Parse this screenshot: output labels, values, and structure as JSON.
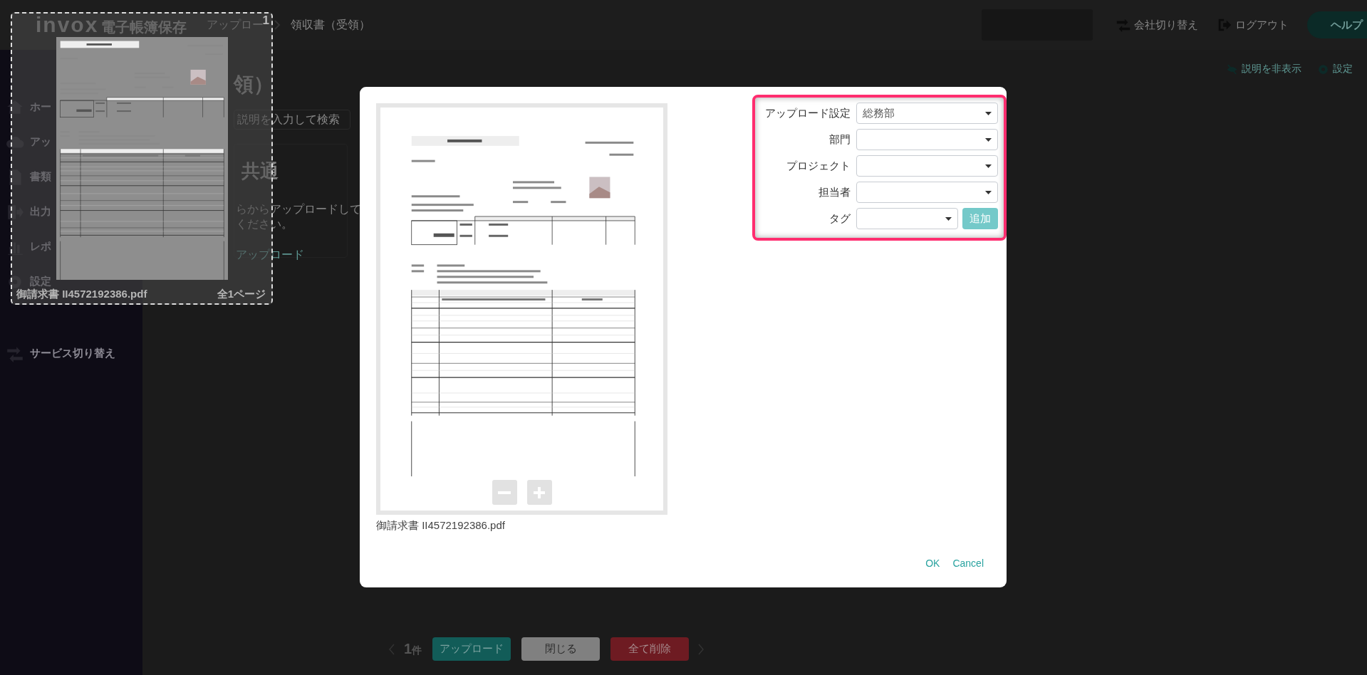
{
  "header": {
    "logo": "invox",
    "logo_subtitle": "電子帳簿保存",
    "breadcrumb": [
      "アップロー",
      "領収書（受領）"
    ],
    "actions": [
      {
        "kind": "switch",
        "label": "会社切り替え"
      },
      {
        "kind": "logout",
        "label": "ログアウト"
      }
    ],
    "help_button": "ヘルプ"
  },
  "toolbar": [
    {
      "kind": "hide",
      "label": "説明を非表示"
    },
    {
      "kind": "settings",
      "label": "設定"
    }
  ],
  "sidebar": {
    "items": [
      {
        "kind": "home",
        "label": "ホー"
      },
      {
        "kind": "upload",
        "label": "アッ"
      },
      {
        "kind": "document",
        "label": "書類"
      },
      {
        "kind": "export",
        "label": "出力"
      },
      {
        "kind": "report",
        "label": "レポ"
      },
      {
        "kind": "settings",
        "label": "設定"
      }
    ],
    "switch_label": "サービス切り替え"
  },
  "main": {
    "title": "領）",
    "search": {
      "placeholder": "説明を入力して検索"
    },
    "card": {
      "title": "共通",
      "text_lines": [
        "らからアップロードして",
        "ください。"
      ],
      "link": "アップロード"
    }
  },
  "drag_preview": {
    "count": "1",
    "filename": "御請求書 II4572192386.pdf",
    "pages": "全1ページ"
  },
  "dialog": {
    "preview_filename": "御請求書 II4572192386.pdf",
    "fields": [
      {
        "label": "アップロード設定",
        "value": "総務部"
      },
      {
        "label": "部門"
      },
      {
        "label": "プロジェクト"
      },
      {
        "label": "担当者"
      },
      {
        "label": "タグ",
        "add_button": "追加"
      }
    ],
    "ok": "OK",
    "cancel": "Cancel"
  },
  "footer": {
    "count": "1",
    "unit": "件",
    "buttons": [
      {
        "kind": "upload",
        "label": "アップロード"
      },
      {
        "kind": "close",
        "label": "閉じる"
      },
      {
        "kind": "delete",
        "label": "全て削除"
      }
    ]
  }
}
